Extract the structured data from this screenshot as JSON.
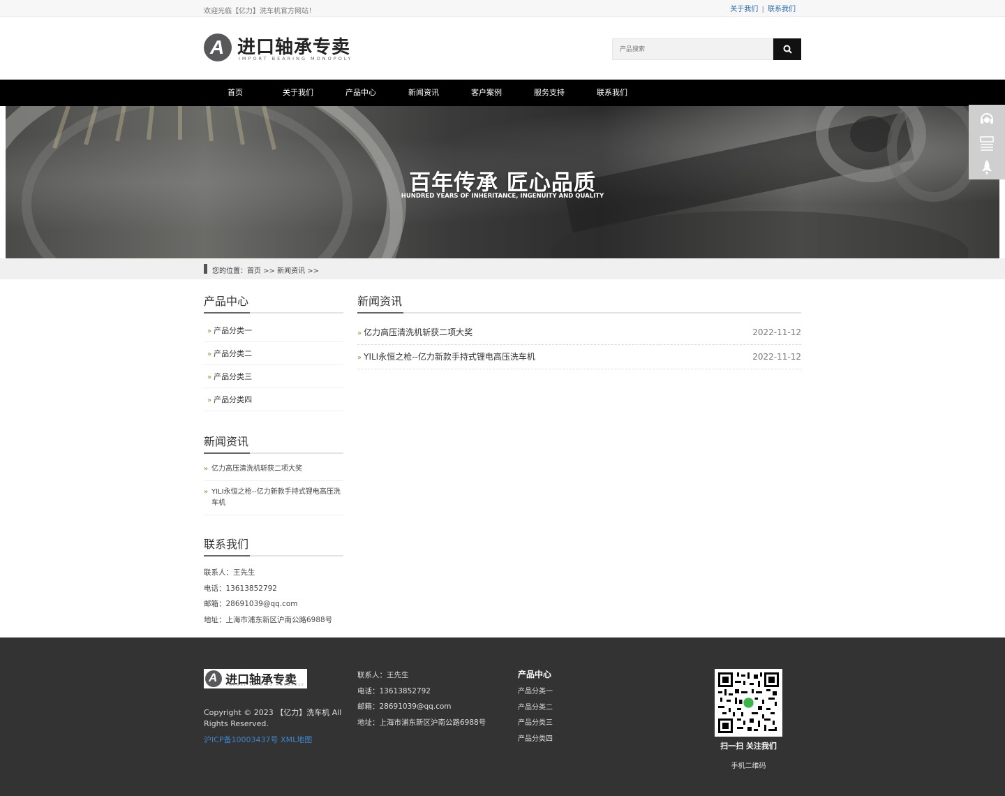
{
  "topbar": {
    "welcome": "欢迎光临【亿力】洗车机官方网站！",
    "about_link": "关于我们",
    "separator": "|",
    "contact_link": "联系我们"
  },
  "header": {
    "logo_letter": "A",
    "logo_name": "进口轴承专卖",
    "logo_sub": "IMPORT BEARING MONOPOLY",
    "search_placeholder": "产品搜索"
  },
  "nav": {
    "items": [
      "首页",
      "关于我们",
      "产品中心",
      "新闻资讯",
      "客户案例",
      "服务支持",
      "联系我们"
    ]
  },
  "banner": {
    "title": "百年传承 匠心品质",
    "subtitle": "HUNDRED YEARS OF INHERITANCE, INGENUITY AND QUALITY"
  },
  "sidefloat": {
    "icons": [
      "headset-icon",
      "qrcode-icon",
      "rocket-icon"
    ]
  },
  "breadcrumb": {
    "text": "您的位置：首页 >> 新闻资讯 >>"
  },
  "left": {
    "products_title": "产品中心",
    "products": [
      "产品分类一",
      "产品分类二",
      "产品分类三",
      "产品分类四"
    ],
    "news_title": "新闻资讯",
    "news": [
      "亿力高压清洗机斩获二项大奖",
      "YILI永恒之枪--亿力新款手持式锂电高压洗车机"
    ],
    "contact_title": "联系我们",
    "contact": {
      "person": "联系人：王先生",
      "phone": "电话：13613852792",
      "email": "邮箱：28691039@qq.com",
      "address": "地址：上海市浦东新区沪南公路6988号"
    }
  },
  "main": {
    "title": "新闻资讯",
    "news": [
      {
        "title": "亿力高压清洗机斩获二项大奖",
        "date": "2022-11-12"
      },
      {
        "title": "YILI永恒之枪--亿力新款手持式锂电高压洗车机",
        "date": "2022-11-12"
      }
    ]
  },
  "footer": {
    "logo_letter": "A",
    "logo_name": "进口轴承专卖",
    "logo_sub": "IMPORT BEARING MONOPOLY",
    "copyright": "Copyright © 2023 【亿力】洗车机 All Rights Reserved.",
    "icp": "沪ICP备10003437号",
    "sitemap": "XML地图",
    "contact": {
      "person": "联系人：王先生",
      "phone": "电话：13613852792",
      "email": "邮箱：28691039@qq.com",
      "address": "地址：上海市浦东新区沪南公路6988号"
    },
    "cats_title": "产品中心",
    "cats": [
      "产品分类一",
      "产品分类二",
      "产品分类三",
      "产品分类四"
    ],
    "qr_caption": "扫一扫 关注我们",
    "qr_sub": "手机二维码"
  },
  "colors": {
    "nav_bg": "#000000",
    "footer_bg": "#333333",
    "link_blue": "#3b86c9",
    "bullet": "#8a8a3a"
  }
}
